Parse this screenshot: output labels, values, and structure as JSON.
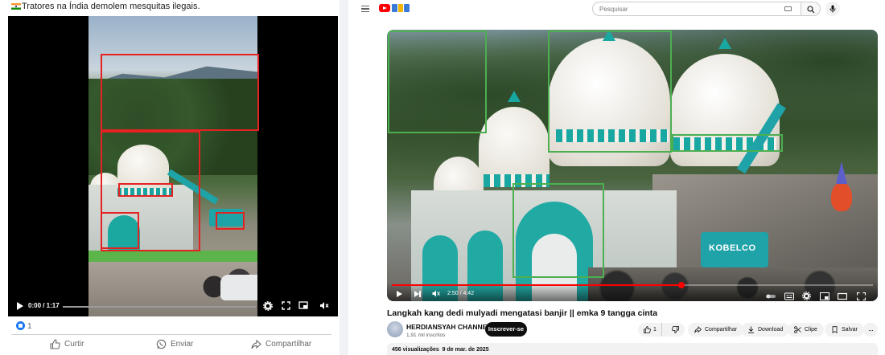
{
  "facebook": {
    "caption": "Tratores na Índia demolem mesquitas ilegais.",
    "video": {
      "time": "0:00 / 1:17",
      "progress": 0.0
    },
    "reactions": {
      "count": "1"
    },
    "actions": {
      "like": "Curtir",
      "send": "Enviar",
      "share": "Compartilhar"
    },
    "box_color": "#e42222"
  },
  "youtube": {
    "search": {
      "placeholder": "Pesquisar"
    },
    "video": {
      "time": "2:50 / 4:42",
      "progress": 0.602,
      "excavator_brand": "KOBELCO",
      "box_color": "#4caf50"
    },
    "title": "Langkah kang dedi mulyadi mengatasi banjir || emka 9 tangga cinta",
    "channel": {
      "name": "HERDIANSYAH CHANNEL",
      "subscribers": "1,91 mil inscritos",
      "subscribe_label": "Inscrever-se"
    },
    "actions": {
      "likes": "1",
      "share": "Compartilhar",
      "download": "Download",
      "clip": "Clipe",
      "save": "Salvar"
    },
    "description_meta": {
      "views": "456 visualizações",
      "date": "9 de mar. de 2025"
    }
  },
  "colors": {
    "fb_blue": "#1877f2",
    "yt_red": "#ff0000",
    "teal": "#19a7a2"
  }
}
